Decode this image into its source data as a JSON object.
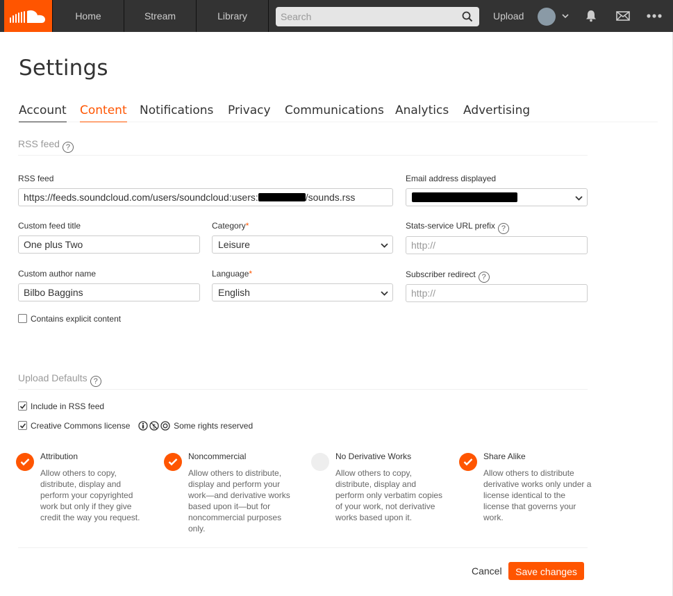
{
  "nav": {
    "home": "Home",
    "stream": "Stream",
    "library": "Library",
    "search_placeholder": "Search",
    "upload": "Upload",
    "brand_color": "#ff5500"
  },
  "page": {
    "title": "Settings",
    "tabs": [
      "Account",
      "Content",
      "Notifications",
      "Privacy",
      "Communications",
      "Analytics",
      "Advertising"
    ],
    "active_tab": "Content"
  },
  "rss": {
    "section_title": "RSS feed",
    "feed_label": "RSS feed",
    "feed_prefix": "https://feeds.soundcloud.com/users/soundcloud:users:",
    "feed_suffix": "/sounds.rss",
    "email_label": "Email address displayed",
    "title_label": "Custom feed title",
    "title_value": "One plus Two",
    "category_label": "Category",
    "category_value": "Leisure",
    "stats_label": "Stats-service URL prefix",
    "stats_placeholder": "http://",
    "author_label": "Custom author name",
    "author_value": "Bilbo Baggins",
    "language_label": "Language",
    "language_value": "English",
    "redirect_label": "Subscriber redirect",
    "redirect_placeholder": "http://",
    "explicit_label": "Contains explicit content",
    "explicit_checked": false,
    "required_mark": "*"
  },
  "upload_defaults": {
    "section_title": "Upload Defaults",
    "include_rss_label": "Include in RSS feed",
    "include_rss_checked": true,
    "cc_label": "Creative Commons license",
    "cc_checked": true,
    "rights_text": "Some rights reserved",
    "licenses": [
      {
        "title": "Attribution",
        "desc": "Allow others to copy, distribute, display and perform your copyrighted work but only if they give credit the way you request.",
        "checked": true
      },
      {
        "title": "Noncommercial",
        "desc": "Allow others to distribute, display and perform your work—and derivative works based upon it—but for noncommercial purposes only.",
        "checked": true
      },
      {
        "title": "No Derivative Works",
        "desc": "Allow others to copy, distribute, display and perform only verbatim copies of your work, not derivative works based upon it.",
        "checked": false
      },
      {
        "title": "Share Alike",
        "desc": "Allow others to distribute derivative works only under a license identical to the license that governs your work.",
        "checked": true
      }
    ]
  },
  "actions": {
    "cancel": "Cancel",
    "save": "Save changes"
  }
}
